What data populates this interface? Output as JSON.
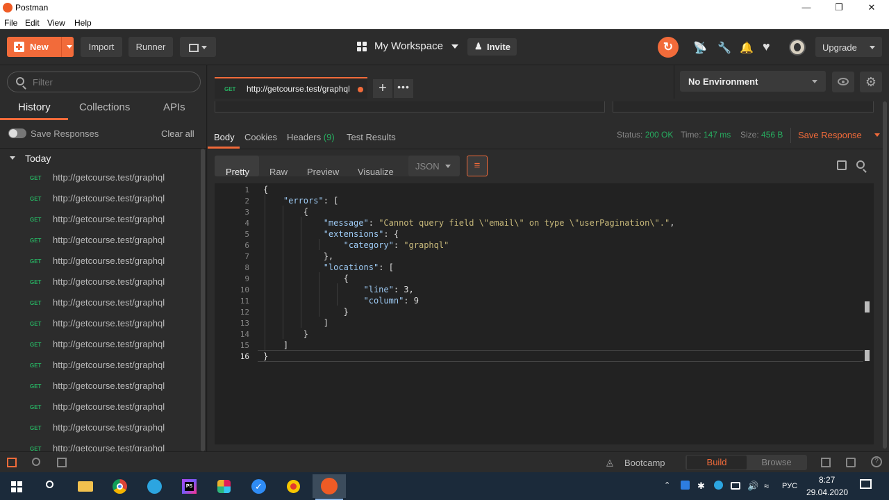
{
  "window": {
    "title": "Postman",
    "minimize": "—",
    "maximize": "❐",
    "close": "✕"
  },
  "menu": [
    "File",
    "Edit",
    "View",
    "Help"
  ],
  "toolbar": {
    "new_label": "New",
    "import_label": "Import",
    "runner_label": "Runner",
    "workspace_label": "My Workspace",
    "invite_label": "Invite",
    "upgrade_label": "Upgrade"
  },
  "sidebar": {
    "filter_placeholder": "Filter",
    "tabs": [
      "History",
      "Collections",
      "APIs"
    ],
    "save_responses_label": "Save Responses",
    "clear_all_label": "Clear all",
    "group_label": "Today",
    "items": [
      {
        "method": "GET",
        "url": "http://getcourse.test/graphql"
      },
      {
        "method": "GET",
        "url": "http://getcourse.test/graphql"
      },
      {
        "method": "GET",
        "url": "http://getcourse.test/graphql"
      },
      {
        "method": "GET",
        "url": "http://getcourse.test/graphql"
      },
      {
        "method": "GET",
        "url": "http://getcourse.test/graphql"
      },
      {
        "method": "GET",
        "url": "http://getcourse.test/graphql"
      },
      {
        "method": "GET",
        "url": "http://getcourse.test/graphql"
      },
      {
        "method": "GET",
        "url": "http://getcourse.test/graphql"
      },
      {
        "method": "GET",
        "url": "http://getcourse.test/graphql"
      },
      {
        "method": "GET",
        "url": "http://getcourse.test/graphql"
      },
      {
        "method": "GET",
        "url": "http://getcourse.test/graphql"
      },
      {
        "method": "GET",
        "url": "http://getcourse.test/graphql"
      },
      {
        "method": "GET",
        "url": "http://getcourse.test/graphql"
      },
      {
        "method": "GET",
        "url": "http://getcourse.test/graphql"
      }
    ]
  },
  "request_tab": {
    "method": "GET",
    "url": "http://getcourse.test/graphql"
  },
  "environment": {
    "selected": "No Environment"
  },
  "response": {
    "tabs": {
      "body": "Body",
      "cookies": "Cookies",
      "headers": "Headers",
      "headers_count": "(9)",
      "tests": "Test Results"
    },
    "status_label": "Status:",
    "status_value": "200 OK",
    "time_label": "Time:",
    "time_value": "147 ms",
    "size_label": "Size:",
    "size_value": "456 B",
    "save_response": "Save Response",
    "formats": [
      "Pretty",
      "Raw",
      "Preview",
      "Visualize"
    ],
    "language": "JSON"
  },
  "code_lines": [
    "{",
    "    \"errors\": [",
    "        {",
    "            \"message\": \"Cannot query field \\\"email\\\" on type \\\"userPagination\\\".\",",
    "            \"extensions\": {",
    "                \"category\": \"graphql\"",
    "            },",
    "            \"locations\": [",
    "                {",
    "                    \"line\": 3,",
    "                    \"column\": 9",
    "                }",
    "            ]",
    "        }",
    "    ]",
    "}"
  ],
  "statusbar": {
    "bootcamp": "Bootcamp",
    "build": "Build",
    "browse": "Browse"
  },
  "taskbar": {
    "lang": "РУС",
    "time": "8:27",
    "date": "29.04.2020"
  },
  "colors": {
    "accent": "#f26b3a",
    "get_method": "#27ae60"
  }
}
